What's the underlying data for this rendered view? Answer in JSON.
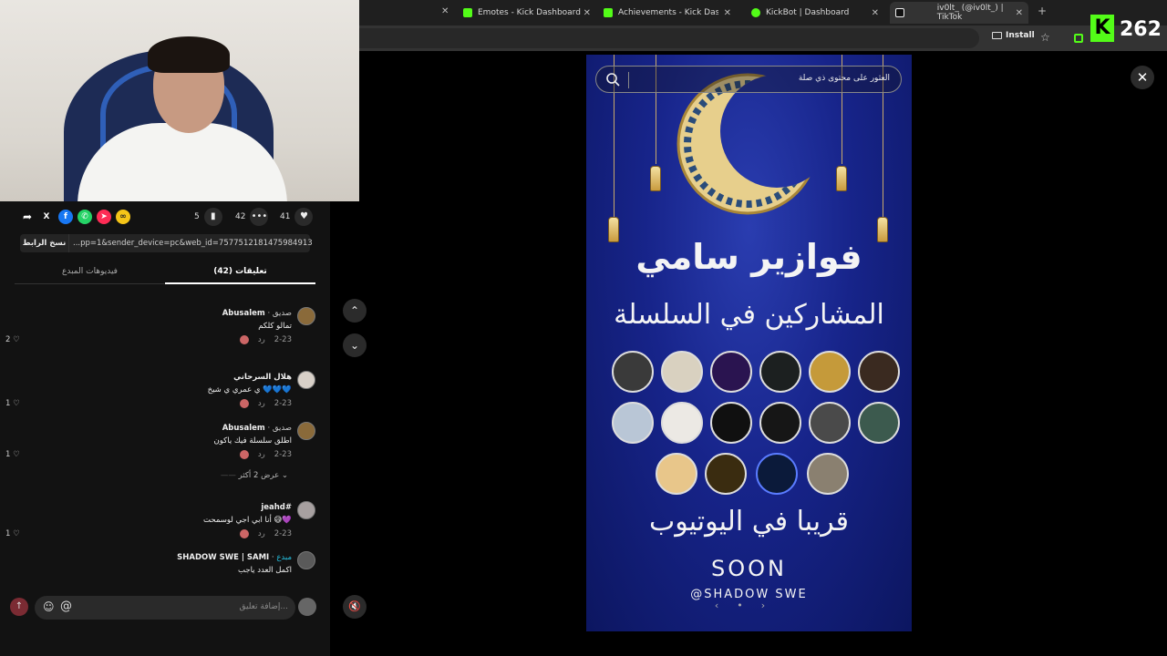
{
  "browser": {
    "tabs": [
      {
        "label": "Emotes - Kick Dashboard",
        "color": "#53fc18"
      },
      {
        "label": "Achievements - Kick Dashboard",
        "color": "#53fc18"
      },
      {
        "label": "KickBot | Dashboard",
        "color": "#53fc18"
      },
      {
        "label": "iv0lt_ (@iv0lt_) | TikTok",
        "color": "#ffffff"
      }
    ],
    "new_tab": "+",
    "install_label": "Install",
    "kick_logo": "K",
    "kick_count": "262"
  },
  "actions": {
    "likes": "41",
    "comments": "42",
    "saves": "5",
    "share_icons": [
      "share-icon",
      "x-icon",
      "facebook-icon",
      "whatsapp-icon",
      "telegram-icon",
      "link-icon"
    ]
  },
  "link": {
    "copy_label": "نسخ الرابط",
    "url": "...pp=1&sender_device=pc&web_id=7577512181475984913"
  },
  "comment_tabs": {
    "creator_videos": "فيديوهات المبدع",
    "comments": "تعليقات (42)"
  },
  "comments": [
    {
      "user": "Abusalem",
      "tag": "صديق",
      "text": "تمالو كلكم",
      "date": "2-23",
      "reply": "رد",
      "likes": "2"
    },
    {
      "user": "هلال السرحاني",
      "tag": "",
      "text": "ي عمري ي شيخ 💙💙💙",
      "date": "2-23",
      "reply": "رد",
      "likes": "1"
    },
    {
      "user": "Abusalem",
      "tag": "صديق",
      "text": "اطلق سلسلة فيك ياكون",
      "date": "2-23",
      "reply": "رد",
      "likes": "1"
    },
    {
      "user": "jeahd#",
      "tag": "",
      "text": "أنا ابي اجي لوسمحت 😅💜",
      "date": "2-23",
      "reply": "رد",
      "likes": "1"
    },
    {
      "user": "SHADOW SWE | SAMI",
      "tag": "مبدع",
      "text": "اكمل العدد ياجب",
      "date": "",
      "reply": "",
      "likes": ""
    }
  ],
  "more_replies": "عرض 2 أكثر",
  "input": {
    "placeholder": "إضافة تعليق..."
  },
  "video": {
    "search_placeholder": "العثور على محتوى ذي صلة",
    "title": "فوازير سامي",
    "subtitle": "المشاركين في السلسلة",
    "coming": "قريبا في اليوتيوب",
    "soon": "SOON",
    "handle": "@SHADOW SWE"
  }
}
